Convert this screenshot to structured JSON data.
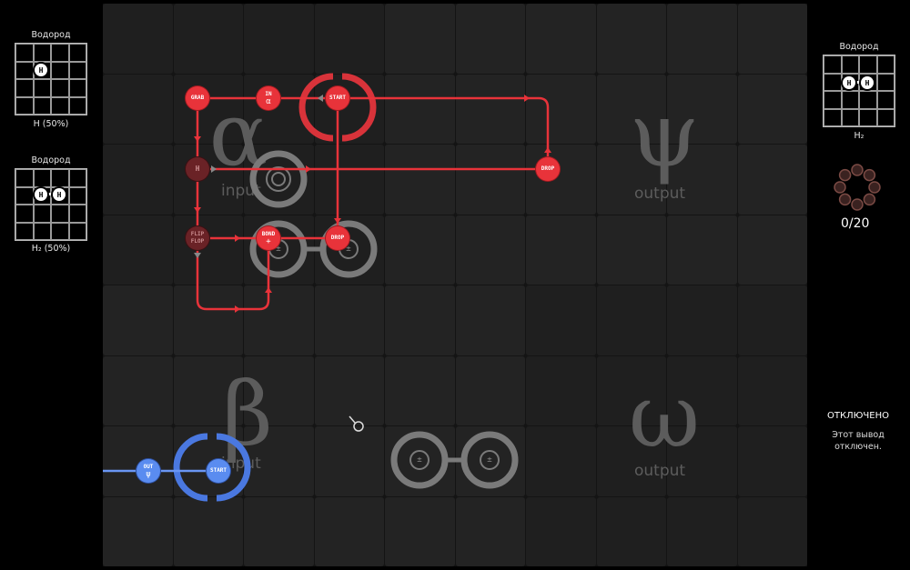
{
  "left_panel": {
    "input_alpha": {
      "title": "Водород",
      "atom": "H",
      "caption": "H (50%)"
    },
    "input_alpha_alt": {
      "title": "Водород",
      "atoms": [
        "H",
        "H"
      ],
      "caption": "H₂ (50%)"
    }
  },
  "right_panel": {
    "output_psi": {
      "title": "Водород",
      "atoms": [
        "H",
        "H"
      ],
      "caption": "H₂"
    },
    "progress": "0/20",
    "output_omega": {
      "title": "ОТКЛЮЧЕНО",
      "text_line1": "Этот вывод",
      "text_line2": "отключен."
    }
  },
  "zones": {
    "alpha": {
      "symbol": "α",
      "label": "input"
    },
    "psi": {
      "symbol": "ψ",
      "label": "output"
    },
    "beta": {
      "symbol": "β",
      "label": "input"
    },
    "omega": {
      "symbol": "ω",
      "label": "output"
    }
  },
  "red_waldo": {
    "grab": "GRAB",
    "in_label": "IN",
    "in_symbol": "α",
    "start": "START",
    "drop_right": "DROP",
    "hold_atom": "H",
    "flipflop_line1": "FLIP",
    "flipflop_line2": "FLOP",
    "bond": "BOND",
    "bond_symbol": "+",
    "drop_mid": "DROP"
  },
  "blue_waldo": {
    "out_label": "OUT",
    "out_symbol": "ψ",
    "start": "START"
  },
  "bonders": {
    "symbol": "±"
  },
  "colors": {
    "red": "#e8333a",
    "blue": "#5a8cf0",
    "board": "#1f1f1f",
    "muted": "#5c5c5c"
  }
}
